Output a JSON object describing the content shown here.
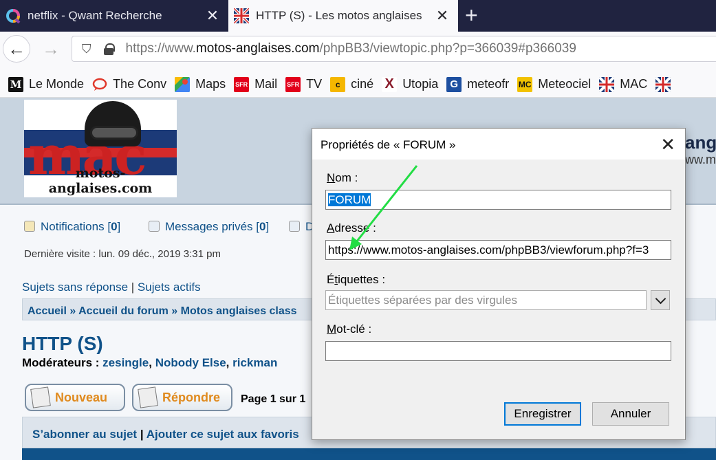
{
  "browser": {
    "tabs": [
      {
        "title": "netflix - Qwant Recherche",
        "favicon": "qwant-icon",
        "active": false
      },
      {
        "title": "HTTP (S) - Les motos anglaises",
        "favicon": "mac-flag-icon",
        "active": true
      }
    ],
    "url_prefix": "https://www.",
    "url_domain": "motos-anglaises.com",
    "url_path": "/phpBB3/viewtopic.php?p=366039#p366039",
    "bookmarks": [
      {
        "label": "Le Monde",
        "icon": "lemonde-icon",
        "color": "#111111",
        "glyph": "M"
      },
      {
        "label": "The Conv",
        "icon": "speech-bubble-icon",
        "color": "#e0382b",
        "glyph": ""
      },
      {
        "label": "Maps",
        "icon": "maps-icon",
        "color": "#34a853",
        "glyph": ""
      },
      {
        "label": "Mail",
        "icon": "sfr-icon",
        "color": "#e2001a",
        "glyph": "SFR"
      },
      {
        "label": "TV",
        "icon": "sfr-icon",
        "color": "#e2001a",
        "glyph": "SFR"
      },
      {
        "label": "ciné",
        "icon": "cine-icon",
        "color": "#f5b700",
        "glyph": "c"
      },
      {
        "label": "Utopia",
        "icon": "utopia-icon",
        "color": "#8a1c2c",
        "glyph": "X"
      },
      {
        "label": "meteofr",
        "icon": "meteofrance-icon",
        "color": "#1d4fa0",
        "glyph": "G"
      },
      {
        "label": "Meteociel",
        "icon": "meteociel-icon",
        "color": "#f2c200",
        "glyph": "MC"
      },
      {
        "label": "MAC",
        "icon": "mac-flag-icon",
        "color": "#1c3a78",
        "glyph": ""
      }
    ]
  },
  "page": {
    "logo_text": "motos-anglaises.com",
    "logo_letters": "mac",
    "header_title_fragment": "ang",
    "header_sub_fragment": "ww.m",
    "notifications_label": "Notifications",
    "notifications_count": "0",
    "messages_label": "Messages privés",
    "messages_count": "0",
    "third_link_fragment": "D",
    "last_visit": "Dernière visite : lun. 09 déc., 2019 3:31 pm",
    "link_unanswered": "Sujets sans réponse",
    "link_active": "Sujets actifs",
    "breadcrumb": [
      "Accueil",
      "Accueil du forum",
      "Motos anglaises class"
    ],
    "topic_title": "HTTP (S)",
    "moderators_label": "Modérateurs :",
    "moderators": [
      "zesingle",
      "Nobody Else",
      "rickman"
    ],
    "btn_new": "Nouveau",
    "btn_reply": "Répondre",
    "page_info": "Page 1 sur 1",
    "subscribe": "S’abonner au sujet",
    "favorites": "Ajouter ce sujet aux favoris"
  },
  "dialog": {
    "title": "Propriétés de « FORUM »",
    "name_label_first": "N",
    "name_label_rest": "om :",
    "name_value": "FORUM",
    "address_label_first": "A",
    "address_label_rest": "dresse :",
    "address_value": "https://www.motos-anglaises.com/phpBB3/viewforum.php?f=3",
    "tags_label_first": "É",
    "tags_label_mid": "t",
    "tags_label_rest": "iquettes :",
    "tags_placeholder": "Étiquettes séparées par des virgules",
    "keyword_label_first": "M",
    "keyword_label_rest": "ot-clé :",
    "keyword_value": "",
    "save_button": "Enregistrer",
    "cancel_button": "Annuler"
  },
  "annotation": {
    "arrow_color": "#22dd44"
  }
}
